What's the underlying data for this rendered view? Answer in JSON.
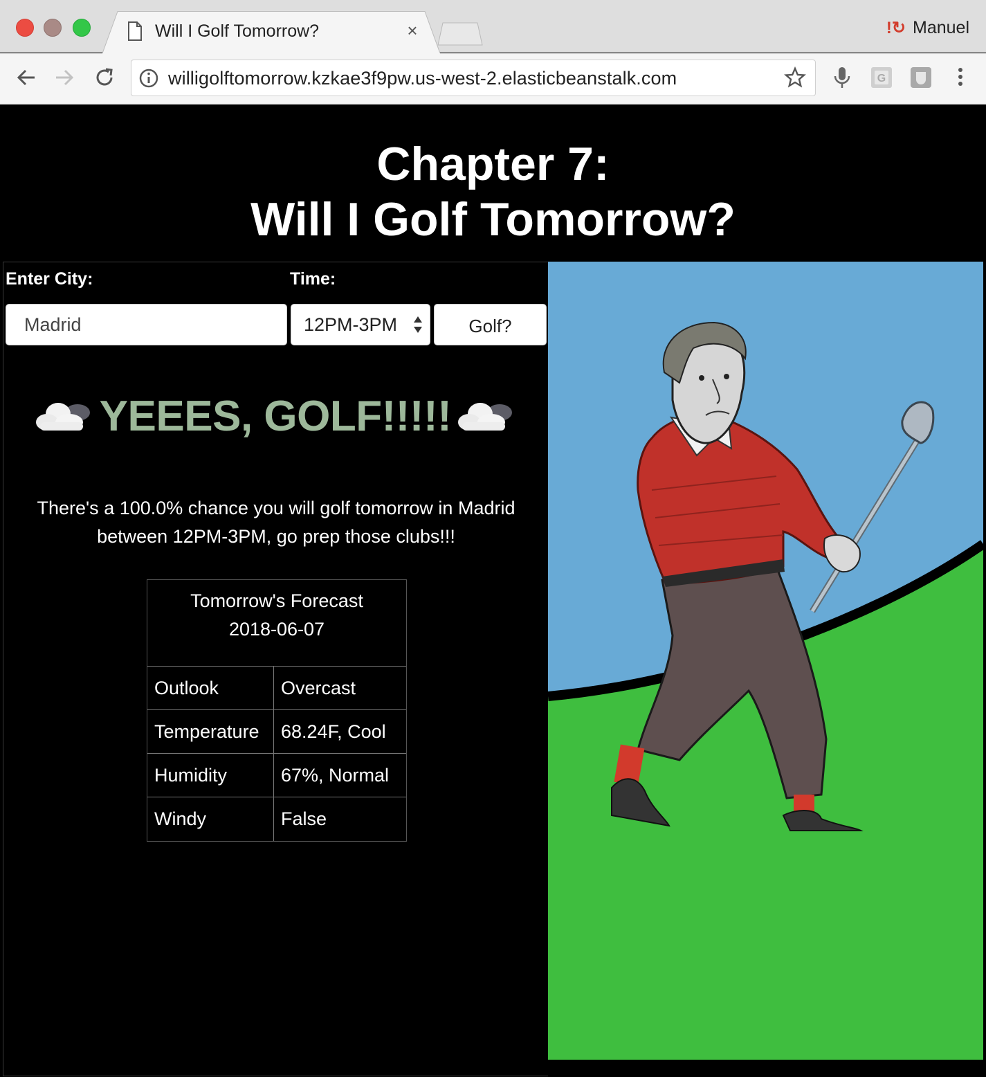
{
  "browser": {
    "tab_title": "Will I Golf Tomorrow?",
    "tab_close": "×",
    "profile_name": "Manuel",
    "url": "willigolftomorrow.kzkae3f9pw.us-west-2.elasticbeanstalk.com",
    "icons": [
      "back-icon",
      "forward-icon",
      "reload-icon",
      "info-icon",
      "star-icon",
      "microphone-icon",
      "extension-g-icon",
      "extension-shield-icon",
      "menu-dots-icon"
    ]
  },
  "page": {
    "heading_line1": "Chapter 7:",
    "heading_line2": "Will I Golf Tomorrow?",
    "city_label": "Enter City:",
    "city_value": "Madrid",
    "time_label": "Time:",
    "time_selected": "12PM-3PM",
    "submit_label": "Golf?",
    "verdict": "YEEES, GOLF!!!!!",
    "message_line1": "There's a 100.0% chance you will golf tomorrow in Madrid",
    "message_line2": "between 12PM-3PM, go prep those clubs!!!",
    "forecast": {
      "title_line1": "Tomorrow's Forecast",
      "title_line2": "2018-06-07",
      "rows": [
        {
          "key": "Outlook",
          "value": "Overcast"
        },
        {
          "key": "Temperature",
          "value": "68.24F, Cool"
        },
        {
          "key": "Humidity",
          "value": "67%, Normal"
        },
        {
          "key": "Windy",
          "value": "False"
        }
      ]
    }
  },
  "colors": {
    "verdict": "#9db89a",
    "sky": "#68aad6",
    "grass": "#3fbe3f",
    "sweater": "#c0312a",
    "trousers": "#5e4f4f"
  }
}
